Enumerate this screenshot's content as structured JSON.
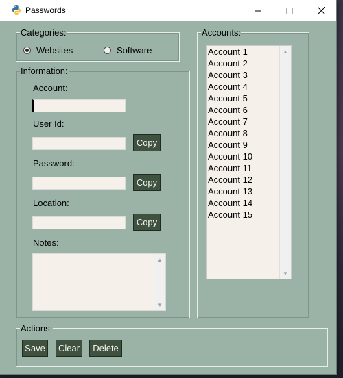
{
  "window": {
    "title": "Passwords",
    "icon": "python-icon",
    "controls": {
      "minimize": "minimize-icon",
      "maximize": "maximize-icon",
      "close": "close-icon"
    }
  },
  "categories": {
    "label": "Categories:",
    "options": [
      {
        "label": "Websites",
        "checked": true
      },
      {
        "label": "Software",
        "checked": false
      }
    ]
  },
  "information": {
    "label": "Information:",
    "account": {
      "label": "Account:",
      "value": ""
    },
    "user_id": {
      "label": "User Id:",
      "value": ""
    },
    "password": {
      "label": "Password:",
      "value": ""
    },
    "location": {
      "label": "Location:",
      "value": ""
    },
    "notes": {
      "label": "Notes:",
      "value": ""
    },
    "copy_label": "Copy"
  },
  "accounts": {
    "label": "Accounts:",
    "items": [
      "Account 1",
      "Account 2",
      "Account 3",
      "Account 4",
      "Account 5",
      "Account 6",
      "Account 7",
      "Account 8",
      "Account 9",
      "Account 10",
      "Account 11",
      "Account 12",
      "Account 13",
      "Account 14",
      "Account 15"
    ]
  },
  "actions": {
    "label": "Actions:",
    "save": "Save",
    "clear": "Clear",
    "delete": "Delete"
  },
  "colors": {
    "window_bg": "#9bb3a6",
    "button_bg": "#3e523f",
    "input_bg": "#f5f0ea"
  }
}
